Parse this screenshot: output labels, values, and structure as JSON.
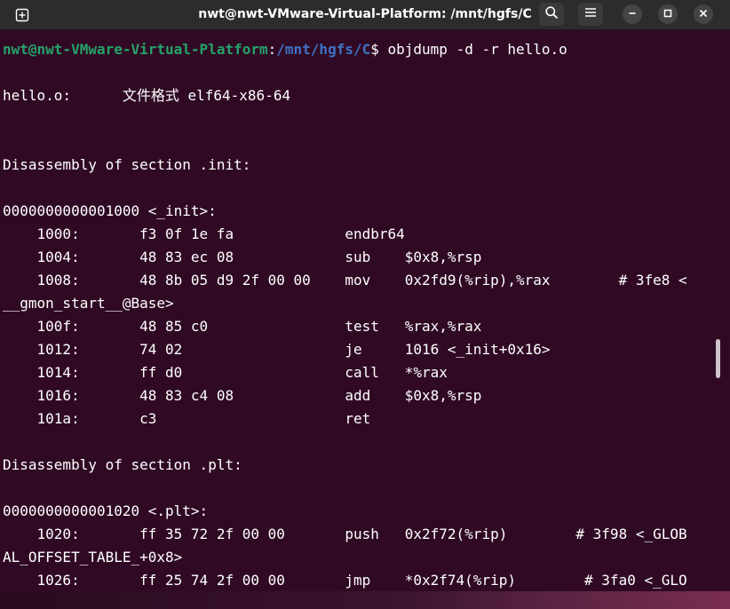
{
  "window": {
    "title": "nwt@nwt-VMware-Virtual-Platform: /mnt/hgfs/C"
  },
  "titlebar": {
    "new_tab_icon": "new-tab-icon",
    "search_icon": "search-icon",
    "menu_icon": "hamburger-menu-icon",
    "minimize_icon": "minimize-icon",
    "maximize_icon": "maximize-icon",
    "close_icon": "close-icon"
  },
  "prompt": {
    "user_host": "nwt@nwt-VMware-Virtual-Platform",
    "separator": ":",
    "path": "/mnt/hgfs/C",
    "symbol": "$ ",
    "command": "objdump -d -r hello.o"
  },
  "output_lines": [
    "",
    "hello.o:      文件格式 elf64-x86-64",
    "",
    "",
    "Disassembly of section .init:",
    "",
    "0000000000001000 <_init>:",
    "    1000:       f3 0f 1e fa             endbr64",
    "    1004:       48 83 ec 08             sub    $0x8,%rsp",
    "    1008:       48 8b 05 d9 2f 00 00    mov    0x2fd9(%rip),%rax        # 3fe8 <",
    "__gmon_start__@Base>",
    "    100f:       48 85 c0                test   %rax,%rax",
    "    1012:       74 02                   je     1016 <_init+0x16>",
    "    1014:       ff d0                   call   *%rax",
    "    1016:       48 83 c4 08             add    $0x8,%rsp",
    "    101a:       c3                      ret",
    "",
    "Disassembly of section .plt:",
    "",
    "0000000000001020 <.plt>:",
    "    1020:       ff 35 72 2f 00 00       push   0x2f72(%rip)        # 3f98 <_GLOB",
    "AL_OFFSET_TABLE_+0x8>",
    "    1026:       ff 25 74 2f 00 00       jmp    *0x2f74(%rip)        # 3fa0 <_GLO"
  ],
  "colors": {
    "terminal_bg": "#300a24",
    "titlebar_bg": "#2c2c2c",
    "prompt_user": "#26a269",
    "prompt_path": "#3f72c4",
    "text": "#ffffff"
  }
}
